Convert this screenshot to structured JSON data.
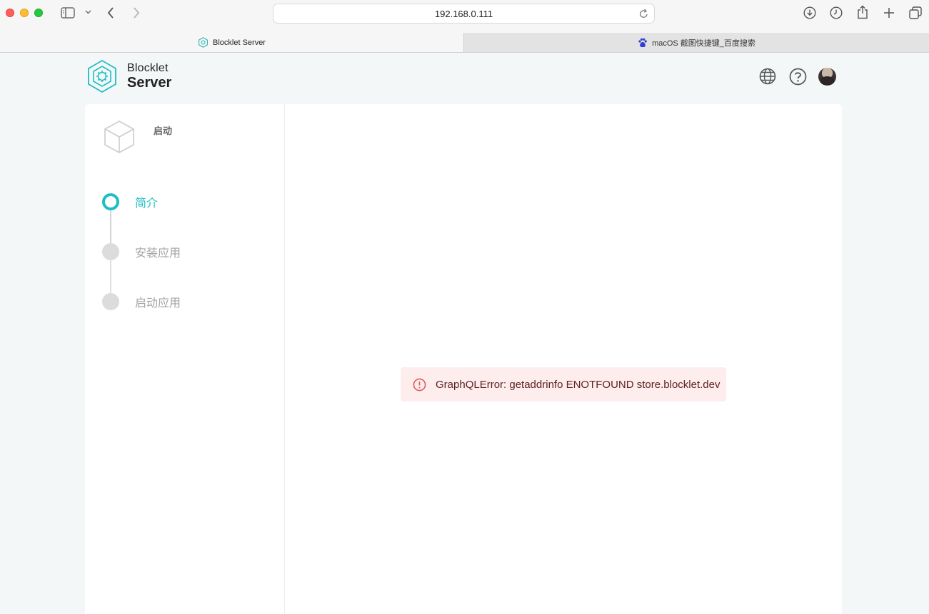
{
  "browser": {
    "url": "192.168.0.111",
    "tabs": [
      {
        "title": "Blocklet Server",
        "active": true
      },
      {
        "title": "macOS 截图快捷键_百度搜索",
        "active": false
      }
    ]
  },
  "header": {
    "logo_line1": "Blocklet",
    "logo_line2": "Server"
  },
  "sidebar": {
    "title": "启动",
    "steps": [
      {
        "label": "简介",
        "state": "active"
      },
      {
        "label": "安装应用",
        "state": "pending"
      },
      {
        "label": "启动应用",
        "state": "pending"
      }
    ]
  },
  "alert": {
    "message": "GraphQLError: getaddrinfo ENOTFOUND store.blocklet.dev"
  },
  "colors": {
    "accent": "#1dbfc4",
    "error_bg": "#fdeded",
    "error_icon": "#e25b5b"
  }
}
